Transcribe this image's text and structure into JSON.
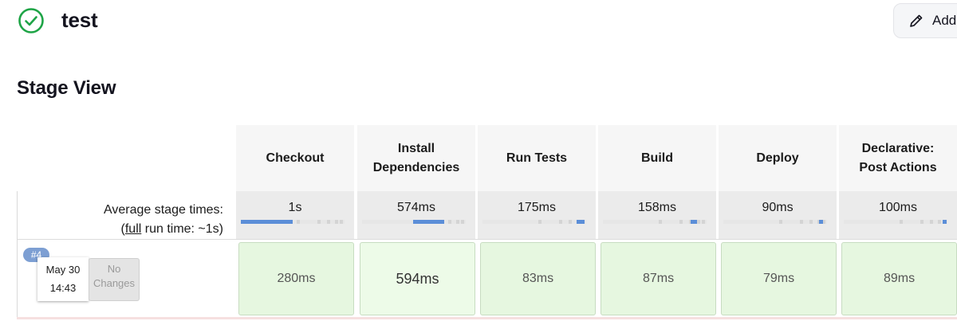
{
  "header": {
    "job_name": "test",
    "status_icon": "check-circle-icon",
    "status_color": "#1ea446",
    "add_button_label": "Add"
  },
  "stage_view": {
    "title": "Stage View",
    "avg_label_line1": "Average stage times:",
    "avg_label_link": "full",
    "avg_label_rest": " run time: ~1s)",
    "avg_label_open": "(",
    "stages": [
      {
        "name_l1": "Checkout",
        "name_l2": "",
        "avg": "1s",
        "avg_fraction": 0.5
      },
      {
        "name_l1": "Install",
        "name_l2": "Dependencies",
        "avg": "574ms",
        "avg_fraction": 0.3
      },
      {
        "name_l1": "Run Tests",
        "name_l2": "",
        "avg": "175ms",
        "avg_fraction": 0.08
      },
      {
        "name_l1": "Build",
        "name_l2": "",
        "avg": "158ms",
        "avg_fraction": 0.06
      },
      {
        "name_l1": "Deploy",
        "name_l2": "",
        "avg": "90ms",
        "avg_fraction": 0.04
      },
      {
        "name_l1": "Declarative:",
        "name_l2": "Post Actions",
        "avg": "100ms",
        "avg_fraction": 0.04
      }
    ],
    "builds": [
      {
        "number": "#4",
        "date": "May 30",
        "time": "14:43",
        "changes_l1": "No",
        "changes_l2": "Changes",
        "stage_times": [
          "280ms",
          "594ms",
          "83ms",
          "87ms",
          "79ms",
          "89ms"
        ]
      }
    ],
    "colors": {
      "success_cell": "#e6f7e0",
      "progress_bar": "#5b8ed8",
      "badge": "#7d9fd3"
    }
  }
}
